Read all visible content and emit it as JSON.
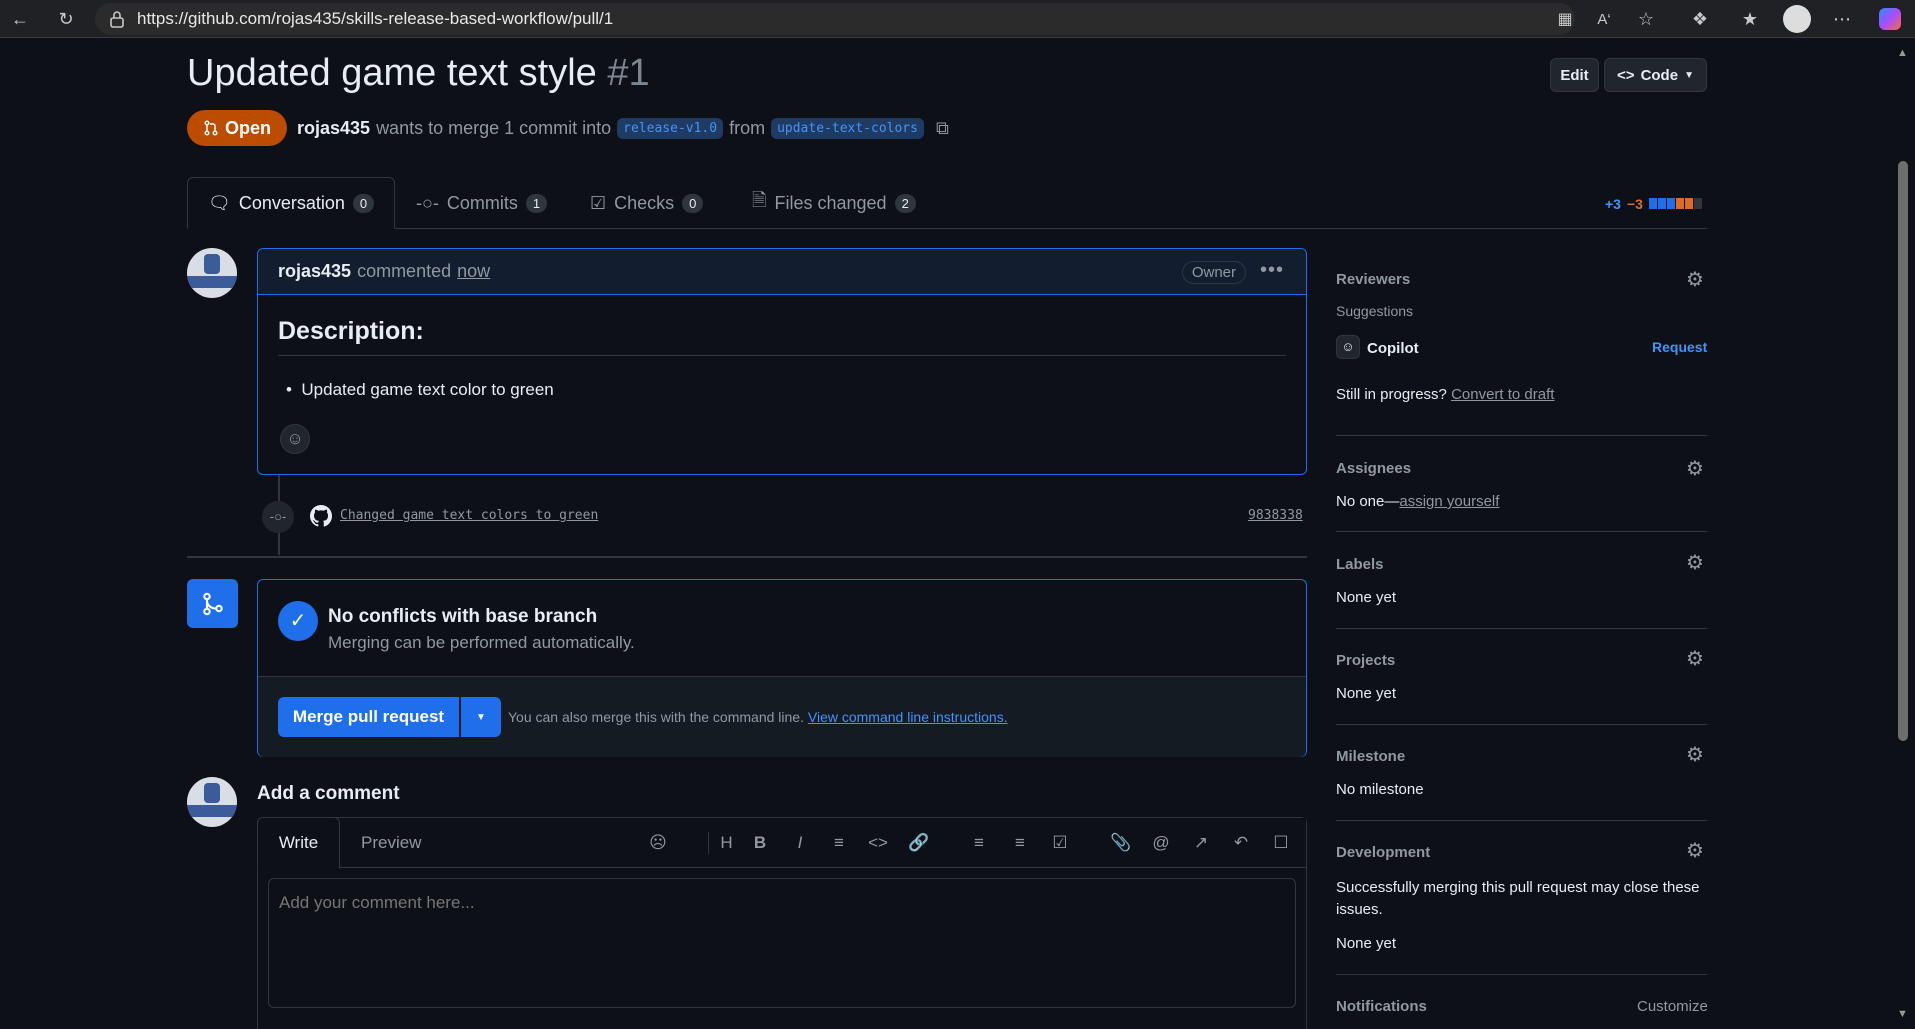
{
  "browser": {
    "url": "https://github.com/rojas435/skills-release-based-workflow/pull/1"
  },
  "pr": {
    "title": "Updated game text style",
    "number": "#1",
    "status": "Open",
    "author": "rojas435",
    "merge_text": "wants to merge 1 commit into",
    "base_branch": "release-v1.0",
    "from_text": "from",
    "head_branch": "update-text-colors",
    "edit_label": "Edit",
    "code_label": "Code"
  },
  "tabs": [
    {
      "label": "Conversation",
      "count": "0"
    },
    {
      "label": "Commits",
      "count": "1"
    },
    {
      "label": "Checks",
      "count": "0"
    },
    {
      "label": "Files changed",
      "count": "2"
    }
  ],
  "diffstat": {
    "added": "+3",
    "removed": "−3"
  },
  "comment": {
    "author": "rojas435",
    "action": "commented",
    "time": "now",
    "badge": "Owner",
    "heading": "Description:",
    "bullet": "Updated game text color to green"
  },
  "commit": {
    "message": "Changed game text colors to green",
    "sha": "9838338"
  },
  "merge": {
    "title": "No conflicts with base branch",
    "subtitle": "Merging can be performed automatically.",
    "button": "Merge pull request",
    "note": "You can also merge this with the command line.",
    "link": "View command line instructions."
  },
  "add_comment": {
    "title": "Add a comment",
    "tab_write": "Write",
    "tab_preview": "Preview",
    "placeholder": "Add your comment here..."
  },
  "sidebar": {
    "reviewers": "Reviewers",
    "suggestions": "Suggestions",
    "copilot": "Copilot",
    "request": "Request",
    "still": "Still in progress?",
    "convert": "Convert to draft",
    "assignees": "Assignees",
    "assignees_value": "No one—",
    "assign_yourself": "assign yourself",
    "labels": "Labels",
    "labels_value": "None yet",
    "projects": "Projects",
    "projects_value": "None yet",
    "milestone": "Milestone",
    "milestone_value": "No milestone",
    "development": "Development",
    "development_text": "Successfully merging this pull request may close these issues.",
    "development_value": "None yet",
    "notifications": "Notifications",
    "customize": "Customize"
  }
}
